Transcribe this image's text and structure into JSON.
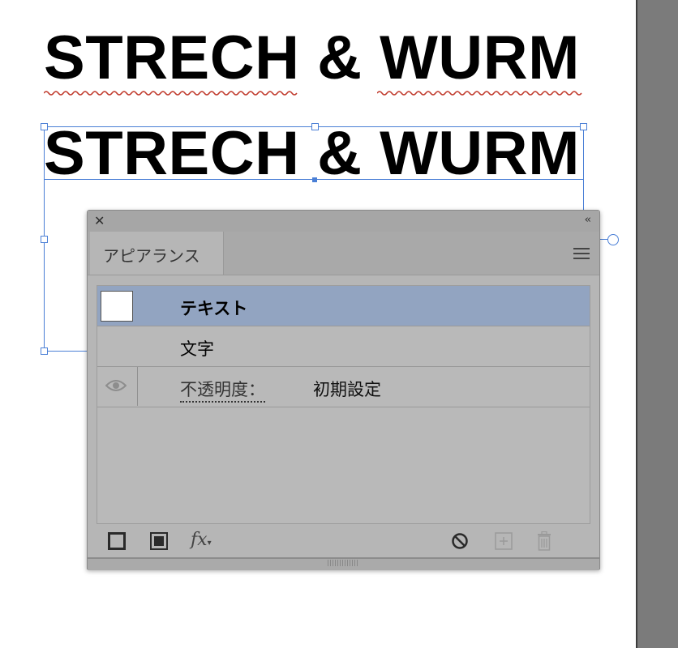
{
  "document": {
    "headline_text": "STRECH & WURM",
    "selected_text": "STRECH & WURM"
  },
  "panel": {
    "close_glyph": "✕",
    "collapse_glyph": "‹‹",
    "tab_label": "アピアランス",
    "rows": [
      {
        "label": "テキスト",
        "selected": true
      },
      {
        "label": "文字"
      },
      {
        "label": "不透明度：",
        "value": "初期設定",
        "visibility": "eye-icon"
      }
    ],
    "footer_icons": [
      "add-stroke-icon",
      "add-fill-icon",
      "fx-icon",
      "clear-appearance-icon",
      "duplicate-item-icon",
      "delete-icon"
    ],
    "fx_label": "fx"
  },
  "colors": {
    "selection": "#4a7fd6",
    "spellcheck": "#c0392b",
    "selected_row": "#92a4c1",
    "panel_bg": "#b6b6b6"
  }
}
